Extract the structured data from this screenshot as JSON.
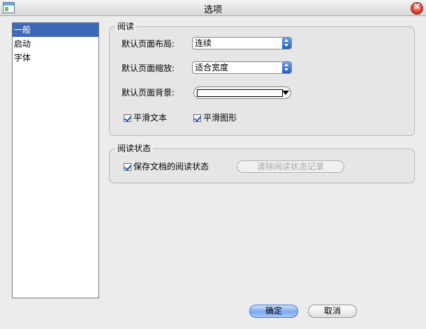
{
  "window": {
    "title": "选项"
  },
  "sidebar": {
    "items": [
      {
        "label": "一般",
        "selected": true
      },
      {
        "label": "启动",
        "selected": false
      },
      {
        "label": "字体",
        "selected": false
      }
    ]
  },
  "reading": {
    "legend": "阅读",
    "layout_label": "默认页面布局:",
    "layout_value": "连续",
    "zoom_label": "默认页面缩放:",
    "zoom_value": "适合宽度",
    "background_label": "默认页面背景:",
    "background_color": "#ffffff",
    "smooth_text_label": "平滑文本",
    "smooth_text_checked": true,
    "smooth_graphics_label": "平滑图形",
    "smooth_graphics_checked": true
  },
  "reading_state": {
    "legend": "阅读状态",
    "save_label": "保存文档的阅读状态",
    "save_checked": true,
    "clear_label": "清除阅读状态记录"
  },
  "footer": {
    "ok_label": "确定",
    "cancel_label": "取消"
  },
  "colors": {
    "selection": "#3d6ab8",
    "ok_button": "#7fa9ee",
    "stepper": "#1e5dc8"
  }
}
